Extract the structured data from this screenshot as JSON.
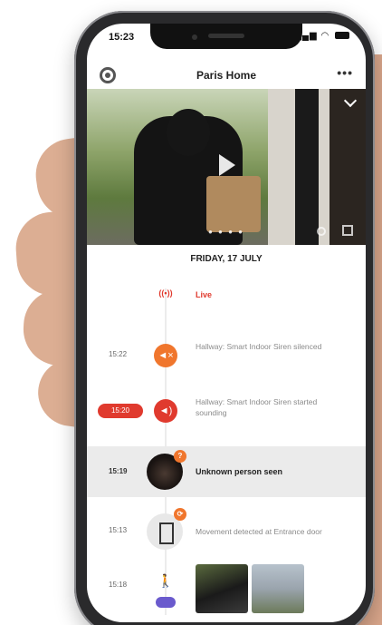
{
  "status_bar": {
    "time": "15:23",
    "icons": "wifi battery"
  },
  "app_bar": {
    "title": "Paris Home",
    "settings_icon": "gear-icon",
    "more_icon": "more-icon",
    "more_glyph": "•••"
  },
  "video": {
    "play_icon": "play-icon",
    "collapse_icon": "chevron-down-icon",
    "page_dots": "● ● ● ●"
  },
  "timeline": {
    "date": "FRIDAY, 17 JULY",
    "live": {
      "label": "Live",
      "glyph": "((•))"
    },
    "events": [
      {
        "time": "15:22",
        "text": "Hallway: Smart Indoor Siren silenced",
        "icon": "siren-muted-icon",
        "glyph": "◄×"
      },
      {
        "time": "15:20",
        "text": "Hallway: Smart Indoor Siren started sounding",
        "icon": "siren-sounding-icon",
        "glyph": "◄)"
      },
      {
        "time": "15:19",
        "text": "Unknown person seen",
        "icon": "unknown-person-avatar",
        "badge": "?"
      },
      {
        "time": "15:13",
        "text": "Movement detected at Entrance door",
        "icon": "door-icon",
        "badge": "⟳"
      },
      {
        "time": "15:18",
        "icon": "walking-person-icon",
        "glyph": "🚶"
      }
    ]
  },
  "colors": {
    "accent_red": "#e03a2e",
    "accent_orange": "#f0762d",
    "highlight_row": "#ebebeb"
  }
}
